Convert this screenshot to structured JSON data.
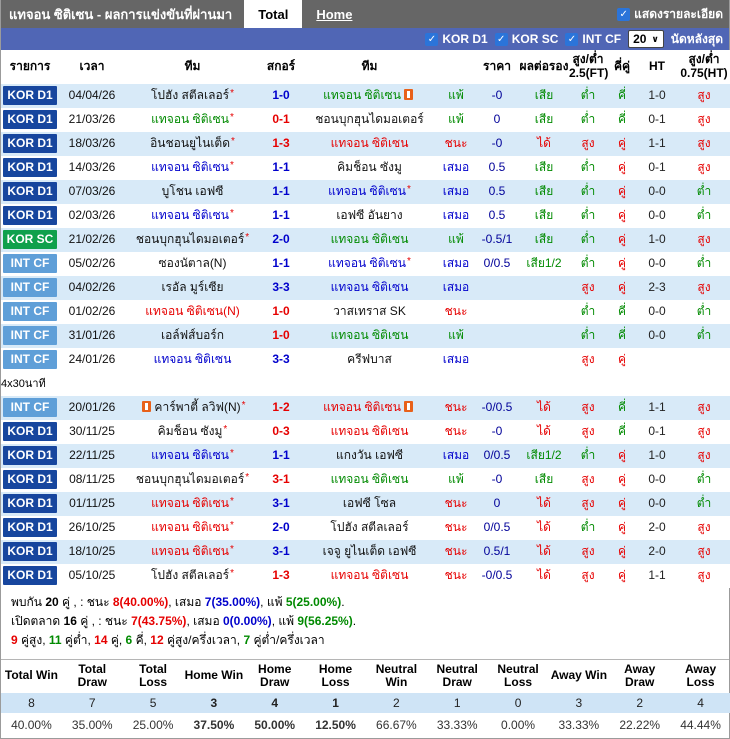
{
  "header": {
    "title": "แทจอน ซิติเซน - ผลการแข่งขันที่ผ่านมา",
    "tabs": [
      {
        "label": "Total",
        "active": true
      },
      {
        "label": "Home",
        "active": false
      }
    ],
    "details_checkbox_label": "แสดงรายละเอียด",
    "details_checkbox_checked": true
  },
  "filter_bar": {
    "leagues": [
      "KOR D1",
      "KOR SC",
      "INT CF"
    ],
    "leagues_checked": [
      true,
      true,
      true
    ],
    "matches_count": "20",
    "matches_label": "นัดหลังสุด"
  },
  "table": {
    "columns": [
      "รายการ",
      "เวลา",
      "ทีม",
      "สกอร์",
      "ทีม",
      "",
      "ราคา",
      "ผลต่อรอง",
      "สูง/ต่ำ 2.5(FT)",
      "คี่คู่",
      "HT",
      "สูง/ต่ำ 0.75(HT)"
    ],
    "rows": [
      {
        "lg": "kor1",
        "league": "KOR D1",
        "date": "04/04/26",
        "h": {
          "n": "โปฮัง สตีลเลอร์",
          "c": "black",
          "a": 1
        },
        "s": "1-0",
        "sc": "blue",
        "aw": {
          "n": "แทจอน ซิติเซน",
          "c": "green",
          "ia": 1
        },
        "res": "แพ้",
        "resc": "green",
        "od": "-0",
        "hr": "เสีย",
        "hrc": "green",
        "ou": "ต่ำ",
        "ouc": "green",
        "oe": "คี่",
        "oec": "green",
        "ht": "1-0",
        "hou": "สูง",
        "houc": "red"
      },
      {
        "lg": "kor1",
        "league": "KOR D1",
        "date": "21/03/26",
        "h": {
          "n": "แทจอน ซิติเซน",
          "c": "green",
          "a": 1
        },
        "s": "0-1",
        "sc": "red",
        "aw": {
          "n": "ชอนบุกฮุนไดมอเตอร์",
          "c": "black"
        },
        "res": "แพ้",
        "resc": "green",
        "od": "0",
        "hr": "เสีย",
        "hrc": "green",
        "ou": "ต่ำ",
        "ouc": "green",
        "oe": "คี่",
        "oec": "green",
        "ht": "0-1",
        "hou": "สูง",
        "houc": "red"
      },
      {
        "lg": "kor1",
        "league": "KOR D1",
        "date": "18/03/26",
        "h": {
          "n": "อินชอนยูไนเต็ด",
          "c": "black",
          "a": 1
        },
        "s": "1-3",
        "sc": "red",
        "aw": {
          "n": "แทจอน ซิติเซน",
          "c": "red"
        },
        "res": "ชนะ",
        "resc": "red",
        "od": "-0",
        "hr": "ได้",
        "hrc": "red",
        "ou": "สูง",
        "ouc": "red",
        "oe": "คู่",
        "oec": "red",
        "ht": "1-1",
        "hou": "สูง",
        "houc": "red"
      },
      {
        "lg": "kor1",
        "league": "KOR D1",
        "date": "14/03/26",
        "h": {
          "n": "แทจอน ซิติเซน",
          "c": "blue",
          "a": 1
        },
        "s": "1-1",
        "sc": "blue",
        "aw": {
          "n": "คิมช็อน ซังมู",
          "c": "black"
        },
        "res": "เสมอ",
        "resc": "blue",
        "od": "0.5",
        "hr": "เสีย",
        "hrc": "green",
        "ou": "ต่ำ",
        "ouc": "green",
        "oe": "คู่",
        "oec": "red",
        "ht": "0-1",
        "hou": "สูง",
        "houc": "red"
      },
      {
        "lg": "kor1",
        "league": "KOR D1",
        "date": "07/03/26",
        "h": {
          "n": "บูโชน เอฟซี",
          "c": "black"
        },
        "s": "1-1",
        "sc": "blue",
        "aw": {
          "n": "แทจอน ซิติเซน",
          "c": "blue",
          "a": 1
        },
        "res": "เสมอ",
        "resc": "blue",
        "od": "0.5",
        "hr": "เสีย",
        "hrc": "green",
        "ou": "ต่ำ",
        "ouc": "green",
        "oe": "คู่",
        "oec": "red",
        "ht": "0-0",
        "hou": "ต่ำ",
        "houc": "green"
      },
      {
        "lg": "kor1",
        "league": "KOR D1",
        "date": "02/03/26",
        "h": {
          "n": "แทจอน ซิติเซน",
          "c": "blue",
          "a": 1
        },
        "s": "1-1",
        "sc": "blue",
        "aw": {
          "n": "เอฟซี อันยาง",
          "c": "black"
        },
        "res": "เสมอ",
        "resc": "blue",
        "od": "0.5",
        "hr": "เสีย",
        "hrc": "green",
        "ou": "ต่ำ",
        "ouc": "green",
        "oe": "คู่",
        "oec": "red",
        "ht": "0-0",
        "hou": "ต่ำ",
        "houc": "green"
      },
      {
        "lg": "korsc",
        "league": "KOR SC",
        "date": "21/02/26",
        "h": {
          "n": "ชอนบุกฮุนไดมอเตอร์",
          "c": "black",
          "a": 1
        },
        "s": "2-0",
        "sc": "blue",
        "aw": {
          "n": "แทจอน ซิติเซน",
          "c": "green"
        },
        "res": "แพ้",
        "resc": "green",
        "od": "-0.5/1",
        "hr": "เสีย",
        "hrc": "green",
        "ou": "ต่ำ",
        "ouc": "green",
        "oe": "คู่",
        "oec": "red",
        "ht": "1-0",
        "hou": "สูง",
        "houc": "red"
      },
      {
        "lg": "intcf",
        "league": "INT CF",
        "date": "05/02/26",
        "h": {
          "n": "ซองนัตาล(N)",
          "c": "black"
        },
        "s": "1-1",
        "sc": "blue",
        "aw": {
          "n": "แทจอน ซิติเซน",
          "c": "blue",
          "a": 1
        },
        "res": "เสมอ",
        "resc": "blue",
        "od": "0/0.5",
        "hr": "เสีย1/2",
        "hrc": "green",
        "ou": "ต่ำ",
        "ouc": "green",
        "oe": "คู่",
        "oec": "red",
        "ht": "0-0",
        "hou": "ต่ำ",
        "houc": "green"
      },
      {
        "lg": "intcf",
        "league": "INT CF",
        "date": "04/02/26",
        "h": {
          "n": "เรอัล มูร์เซีย",
          "c": "black"
        },
        "s": "3-3",
        "sc": "blue",
        "aw": {
          "n": "แทจอน ซิติเซน",
          "c": "blue"
        },
        "res": "เสมอ",
        "resc": "blue",
        "od": "",
        "hr": "",
        "hrc": "black",
        "ou": "สูง",
        "ouc": "red",
        "oe": "คู่",
        "oec": "red",
        "ht": "2-3",
        "hou": "สูง",
        "houc": "red"
      },
      {
        "lg": "intcf",
        "league": "INT CF",
        "date": "01/02/26",
        "h": {
          "n": "แทจอน ซิติเซน(N)",
          "c": "red"
        },
        "s": "1-0",
        "sc": "red",
        "aw": {
          "n": "วาสเทราส SK",
          "c": "black"
        },
        "res": "ชนะ",
        "resc": "red",
        "od": "",
        "hr": "",
        "hrc": "black",
        "ou": "ต่ำ",
        "ouc": "green",
        "oe": "คี่",
        "oec": "green",
        "ht": "0-0",
        "hou": "ต่ำ",
        "houc": "green"
      },
      {
        "lg": "intcf",
        "league": "INT CF",
        "date": "31/01/26",
        "h": {
          "n": "เอล์ฟส์บอร์ก",
          "c": "black"
        },
        "s": "1-0",
        "sc": "red",
        "aw": {
          "n": "แทจอน ซิติเซน",
          "c": "green"
        },
        "res": "แพ้",
        "resc": "green",
        "od": "",
        "hr": "",
        "hrc": "black",
        "ou": "ต่ำ",
        "ouc": "green",
        "oe": "คี่",
        "oec": "green",
        "ht": "0-0",
        "hou": "ต่ำ",
        "houc": "green"
      },
      {
        "lg": "intcf",
        "league": "INT CF",
        "date": "24/01/26",
        "h": {
          "n": "แทจอน ซิติเซน",
          "c": "blue"
        },
        "s": "3-3",
        "sc": "blue",
        "aw": {
          "n": "ครีฟบาส",
          "c": "black"
        },
        "res": "เสมอ",
        "resc": "blue",
        "od": "",
        "hr": "",
        "hrc": "black",
        "ou": "สูง",
        "ouc": "red",
        "oe": "คู่",
        "oec": "red",
        "ht": "",
        "hou": "",
        "houc": "black"
      },
      {
        "separator": "4x30นาที"
      },
      {
        "lg": "intcf",
        "league": "INT CF",
        "date": "20/01/26",
        "h": {
          "n": "คาร์พาตี้ ลวิฟ(N)",
          "c": "black",
          "a": 1,
          "ib": 1
        },
        "s": "1-2",
        "sc": "red",
        "aw": {
          "n": "แทจอน ซิติเซน",
          "c": "red",
          "ia": 1
        },
        "res": "ชนะ",
        "resc": "red",
        "od": "-0/0.5",
        "hr": "ได้",
        "hrc": "red",
        "ou": "สูง",
        "ouc": "red",
        "oe": "คี่",
        "oec": "green",
        "ht": "1-1",
        "hou": "สูง",
        "houc": "red"
      },
      {
        "lg": "kor1",
        "league": "KOR D1",
        "date": "30/11/25",
        "h": {
          "n": "คิมช็อน ซังมู",
          "c": "black",
          "a": 1
        },
        "s": "0-3",
        "sc": "red",
        "aw": {
          "n": "แทจอน ซิติเซน",
          "c": "red"
        },
        "res": "ชนะ",
        "resc": "red",
        "od": "-0",
        "hr": "ได้",
        "hrc": "red",
        "ou": "สูง",
        "ouc": "red",
        "oe": "คี่",
        "oec": "green",
        "ht": "0-1",
        "hou": "สูง",
        "houc": "red"
      },
      {
        "lg": "kor1",
        "league": "KOR D1",
        "date": "22/11/25",
        "h": {
          "n": "แทจอน ซิติเซน",
          "c": "blue",
          "a": 1
        },
        "s": "1-1",
        "sc": "blue",
        "aw": {
          "n": "แกงวัน เอฟซี",
          "c": "black"
        },
        "res": "เสมอ",
        "resc": "blue",
        "od": "0/0.5",
        "hr": "เสีย1/2",
        "hrc": "green",
        "ou": "ต่ำ",
        "ouc": "green",
        "oe": "คู่",
        "oec": "red",
        "ht": "1-0",
        "hou": "สูง",
        "houc": "red"
      },
      {
        "lg": "kor1",
        "league": "KOR D1",
        "date": "08/11/25",
        "h": {
          "n": "ชอนบุกฮุนไดมอเตอร์",
          "c": "black",
          "a": 1
        },
        "s": "3-1",
        "sc": "red",
        "aw": {
          "n": "แทจอน ซิติเซน",
          "c": "green"
        },
        "res": "แพ้",
        "resc": "green",
        "od": "-0",
        "hr": "เสีย",
        "hrc": "green",
        "ou": "สูง",
        "ouc": "red",
        "oe": "คู่",
        "oec": "red",
        "ht": "0-0",
        "hou": "ต่ำ",
        "houc": "green"
      },
      {
        "lg": "kor1",
        "league": "KOR D1",
        "date": "01/11/25",
        "h": {
          "n": "แทจอน ซิติเซน",
          "c": "red",
          "a": 1
        },
        "s": "3-1",
        "sc": "blue",
        "aw": {
          "n": "เอฟซี โซล",
          "c": "black"
        },
        "res": "ชนะ",
        "resc": "red",
        "od": "0",
        "hr": "ได้",
        "hrc": "red",
        "ou": "สูง",
        "ouc": "red",
        "oe": "คู่",
        "oec": "red",
        "ht": "0-0",
        "hou": "ต่ำ",
        "houc": "green"
      },
      {
        "lg": "kor1",
        "league": "KOR D1",
        "date": "26/10/25",
        "h": {
          "n": "แทจอน ซิติเซน",
          "c": "red",
          "a": 1
        },
        "s": "2-0",
        "sc": "blue",
        "aw": {
          "n": "โปฮัง สตีลเลอร์",
          "c": "black"
        },
        "res": "ชนะ",
        "resc": "red",
        "od": "0/0.5",
        "hr": "ได้",
        "hrc": "red",
        "ou": "ต่ำ",
        "ouc": "green",
        "oe": "คู่",
        "oec": "red",
        "ht": "2-0",
        "hou": "สูง",
        "houc": "red"
      },
      {
        "lg": "kor1",
        "league": "KOR D1",
        "date": "18/10/25",
        "h": {
          "n": "แทจอน ซิติเซน",
          "c": "red",
          "a": 1
        },
        "s": "3-1",
        "sc": "blue",
        "aw": {
          "n": "เจจู ยูไนเต็ด เอฟซี",
          "c": "black"
        },
        "res": "ชนะ",
        "resc": "red",
        "od": "0.5/1",
        "hr": "ได้",
        "hrc": "red",
        "ou": "สูง",
        "ouc": "red",
        "oe": "คู่",
        "oec": "red",
        "ht": "2-0",
        "hou": "สูง",
        "houc": "red"
      },
      {
        "lg": "kor1",
        "league": "KOR D1",
        "date": "05/10/25",
        "h": {
          "n": "โปฮัง สตีลเลอร์",
          "c": "black",
          "a": 1
        },
        "s": "1-3",
        "sc": "red",
        "aw": {
          "n": "แทจอน ซิติเซน",
          "c": "red"
        },
        "res": "ชนะ",
        "resc": "red",
        "od": "-0/0.5",
        "hr": "ได้",
        "hrc": "red",
        "ou": "สูง",
        "ouc": "red",
        "oe": "คู่",
        "oec": "red",
        "ht": "1-1",
        "hou": "สูง",
        "houc": "red"
      }
    ]
  },
  "summary": {
    "lines": [
      [
        {
          "t": "พบกัน "
        },
        {
          "t": "20",
          "b": 1
        },
        {
          "t": " คู่ , : ชนะ "
        },
        {
          "t": "8(40.00%)",
          "c": "red",
          "b": 1
        },
        {
          "t": ", เสมอ "
        },
        {
          "t": "7(35.00%)",
          "c": "blue",
          "b": 1
        },
        {
          "t": ", แพ้ "
        },
        {
          "t": "5(25.00%)",
          "c": "green",
          "b": 1
        },
        {
          "t": "."
        }
      ],
      [
        {
          "t": "เปิดตลาด "
        },
        {
          "t": "16",
          "b": 1
        },
        {
          "t": " คู่ , : ชนะ "
        },
        {
          "t": "7(43.75%)",
          "c": "red",
          "b": 1
        },
        {
          "t": ", เสมอ "
        },
        {
          "t": "0(0.00%)",
          "c": "blue",
          "b": 1
        },
        {
          "t": ", แพ้ "
        },
        {
          "t": "9(56.25%)",
          "c": "green",
          "b": 1
        },
        {
          "t": "."
        }
      ],
      [
        {
          "t": "9",
          "c": "red",
          "b": 1
        },
        {
          "t": " คู่สูง, "
        },
        {
          "t": "11",
          "c": "green",
          "b": 1
        },
        {
          "t": " คู่ต่ำ, "
        },
        {
          "t": "14",
          "c": "red",
          "b": 1
        },
        {
          "t": " คู่, "
        },
        {
          "t": "6",
          "c": "green",
          "b": 1
        },
        {
          "t": " คี่, "
        },
        {
          "t": "12",
          "c": "red",
          "b": 1
        },
        {
          "t": " คู่สูง/ครึ่งเวลา, "
        },
        {
          "t": "7",
          "c": "green",
          "b": 1
        },
        {
          "t": " คู่ต่ำ/ครึ่งเวลา"
        }
      ]
    ]
  },
  "stats_table": {
    "headers": [
      "Total Win",
      "Total Draw",
      "Total Loss",
      "Home Win",
      "Home Draw",
      "Home Loss",
      "Neutral Win",
      "Neutral Draw",
      "Neutral Loss",
      "Away Win",
      "Away Draw",
      "Away Loss"
    ],
    "counts": [
      "8",
      "7",
      "5",
      "3",
      "4",
      "1",
      "2",
      "1",
      "0",
      "3",
      "2",
      "4"
    ],
    "percents": [
      "40.00%",
      "35.00%",
      "25.00%",
      "37.50%",
      "50.00%",
      "12.50%",
      "66.67%",
      "33.33%",
      "0.00%",
      "33.33%",
      "22.22%",
      "44.44%"
    ],
    "highlight_columns": [
      3,
      4,
      5
    ]
  },
  "colors": {
    "win_red": "#e60000",
    "loss_green": "#008a00",
    "draw_blue": "#0000cc",
    "odds_navy": "#000099",
    "league_kor_d1": "#17469e",
    "league_kor_sc": "#0fa04c",
    "league_int_cf": "#5f9fd8",
    "filter_bar_blue": "#5066b5",
    "title_bar_gray": "#666666",
    "row_alt_blue": "#d8eaf8",
    "stats_value_row": "#cfe4f6",
    "checkbox_blue": "#2b74d9",
    "home_stats_highlight": "#0000cc",
    "badge_orange": "#e8611a"
  }
}
